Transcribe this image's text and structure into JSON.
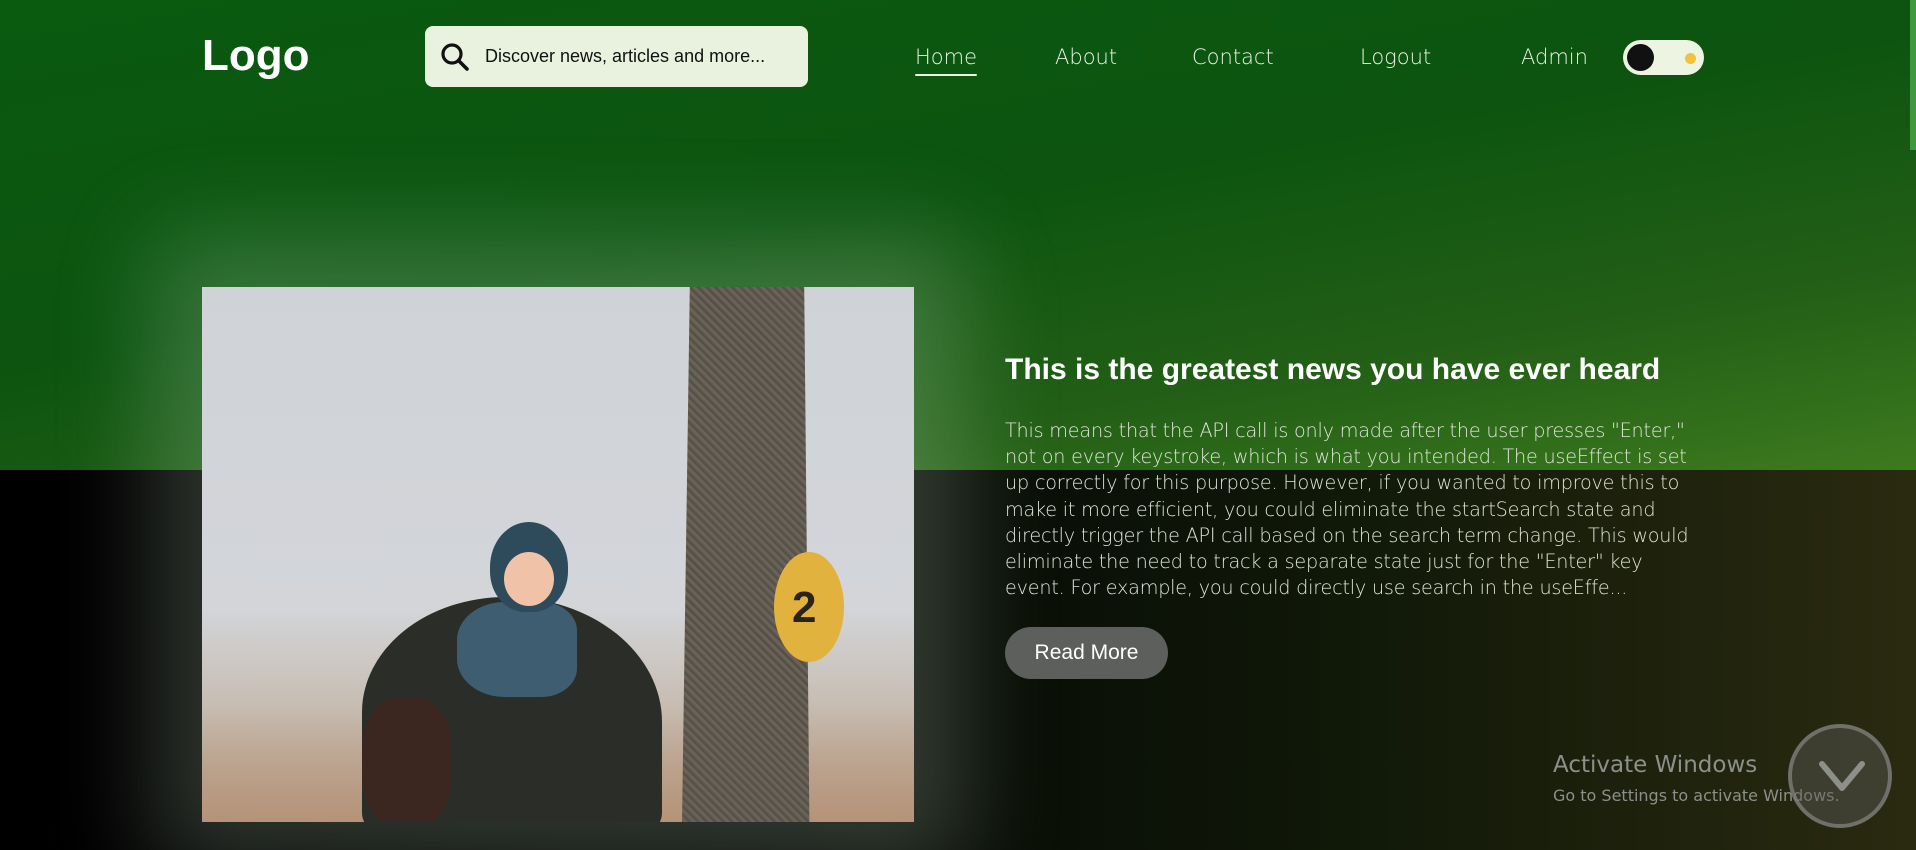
{
  "header": {
    "logo": "Logo",
    "search": {
      "placeholder": "Discover news, articles and more..."
    },
    "nav": [
      {
        "label": "Home",
        "active": true
      },
      {
        "label": "About",
        "active": false
      },
      {
        "label": "Contact",
        "active": false
      },
      {
        "label": "Logout",
        "active": false
      },
      {
        "label": "Admin",
        "active": false
      }
    ],
    "theme_toggle": {
      "icon": "sun-icon",
      "knob": "moon-knob"
    }
  },
  "article": {
    "title": "This is the greatest news you have ever heard",
    "excerpt": "This means that the API call is only made after the user presses \"Enter,\" not on every keystroke, which is what you intended. The useEffect is set up correctly for this purpose. However, if you wanted to improve this to make it more efficient, you could eliminate the startSearch state and directly trigger the API call based on the search term change. This would eliminate the need to track a separate state just for the \"Enter\" key event. For example, you could directly use search in the useEffe...",
    "read_more_label": "Read More",
    "image": {
      "subject": "child-hug-photo",
      "pole_number": "2"
    }
  },
  "system": {
    "watermark_title": "Activate Windows",
    "watermark_subtitle": "Go to Settings to activate Windows."
  },
  "colors": {
    "header_green": "#0c5410",
    "search_bg": "#e9f1df",
    "button_bg": "#5c5f5b",
    "text_light": "#e9f3e3"
  }
}
